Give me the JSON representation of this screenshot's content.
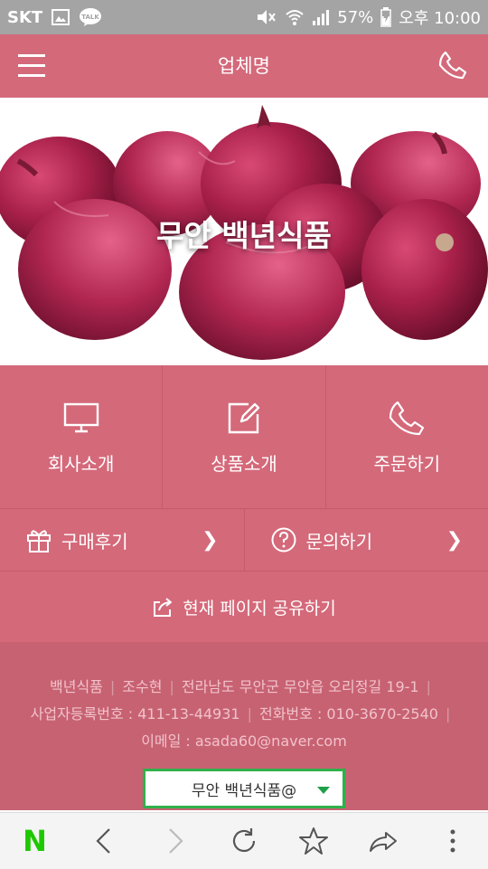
{
  "status_bar": {
    "carrier": "SKT",
    "talk_badge": "TALK",
    "battery": "57%",
    "time": "오후 10:00"
  },
  "header": {
    "title": "업체명",
    "menu_icon": "hamburger-menu-icon",
    "phone_icon": "phone-icon"
  },
  "hero": {
    "title": "무안 백년식품"
  },
  "tiles": [
    {
      "label": "회사소개",
      "icon": "monitor-icon"
    },
    {
      "label": "상품소개",
      "icon": "edit-icon"
    },
    {
      "label": "주문하기",
      "icon": "phone-icon"
    }
  ],
  "links": [
    {
      "label": "구매후기",
      "icon": "gift-icon"
    },
    {
      "label": "문의하기",
      "icon": "question-icon"
    }
  ],
  "share": {
    "label": "현재 페이지 공유하기",
    "icon": "share-icon"
  },
  "footer": {
    "company": "백년식품",
    "owner": "조수현",
    "address": "전라남도 무안군 무안읍 오리정길 19-1",
    "biz_number": "사업자등록번호 : 411-13-44931",
    "phone": "전화번호 : 010-3670-2540",
    "email": "이메일 : asada60@naver.com"
  },
  "dropdown": {
    "value": "무안 백년식품@"
  },
  "colors": {
    "primary": "#d4697a",
    "footer": "#c76272",
    "status_bar": "#a4a4a4",
    "accent_green": "#2fb14b"
  }
}
